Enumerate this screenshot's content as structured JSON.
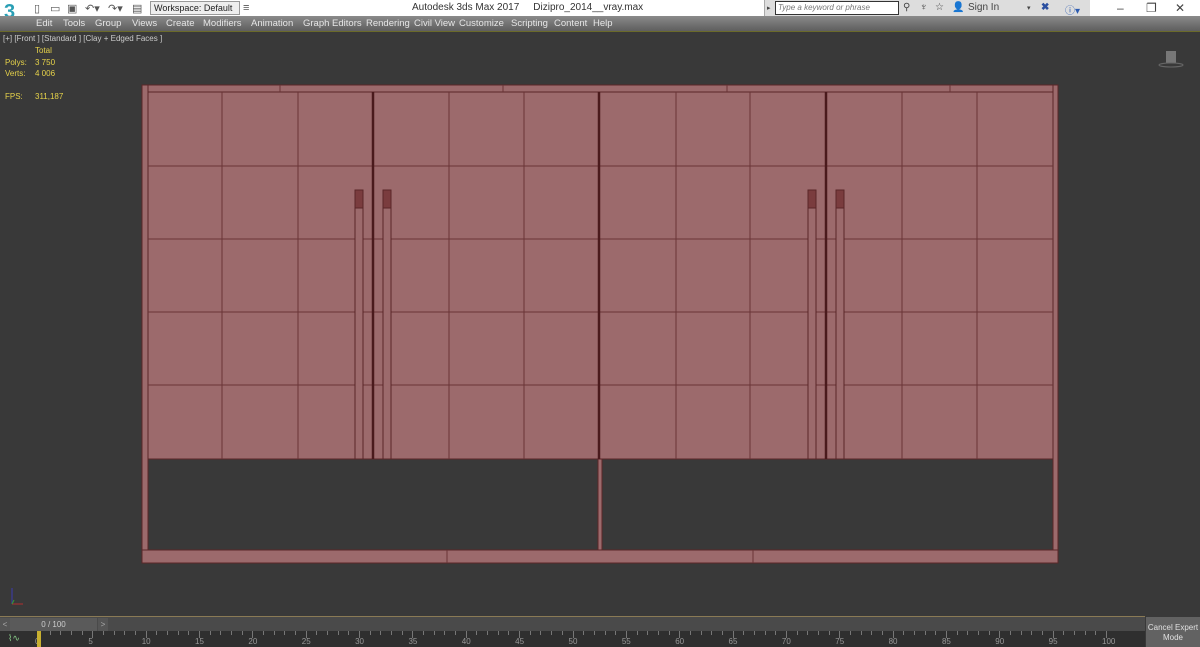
{
  "app": {
    "logo": "3",
    "title": "Autodesk 3ds Max 2017",
    "file": "Dizipro_2014__vray.max",
    "workspace": "Workspace: Default"
  },
  "infocenter": {
    "search_placeholder": "Type a keyword or phrase",
    "sign_in": "Sign In"
  },
  "menu": [
    "Edit",
    "Tools",
    "Group",
    "Views",
    "Create",
    "Modifiers",
    "Animation",
    "Graph Editors",
    "Rendering",
    "Civil View",
    "Customize",
    "Scripting",
    "Content",
    "Help"
  ],
  "viewport": {
    "label": "[+] [Front ] [Standard ] [Clay + Edged Faces ]",
    "stats": {
      "total_label": "Total",
      "polys_label": "Polys:",
      "polys": "3 750",
      "verts_label": "Verts:",
      "verts": "4 006",
      "fps_label": "FPS:",
      "fps": "311,187"
    },
    "model_color": "#9c6a6c"
  },
  "timeline": {
    "frame": "0 / 100",
    "prev": "<",
    "next": ">",
    "ticks": [
      "0",
      "5",
      "10",
      "15",
      "20",
      "25",
      "30",
      "35",
      "40",
      "45",
      "50",
      "55",
      "60",
      "65",
      "70",
      "75",
      "80",
      "85",
      "90",
      "95",
      "100"
    ],
    "current_frame": 0
  },
  "cancel_expert": "Cancel Expert Mode"
}
